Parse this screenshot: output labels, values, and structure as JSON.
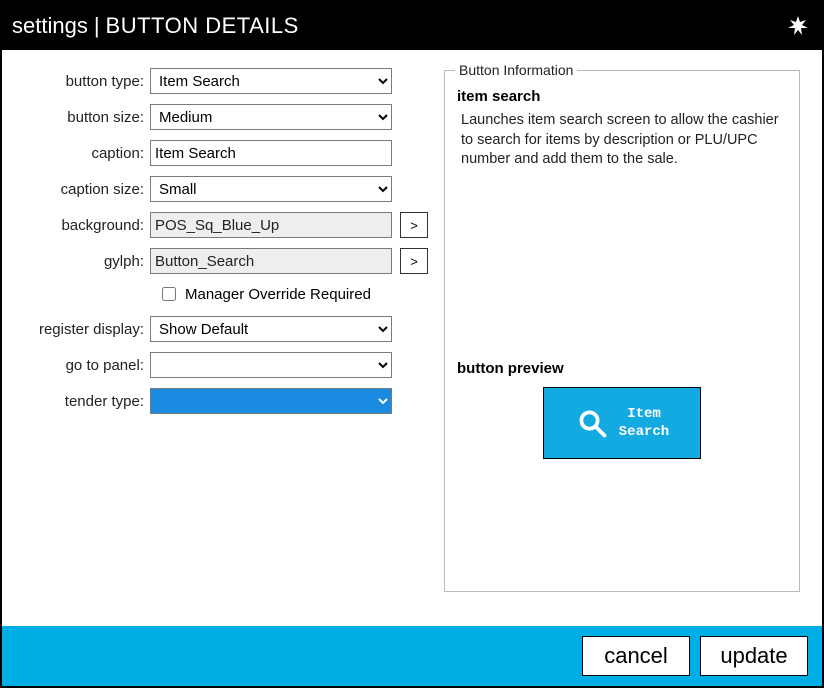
{
  "header": {
    "left": "settings",
    "right": "BUTTON DETAILS"
  },
  "form": {
    "button_type": {
      "label": "button type:",
      "value": "Item Search"
    },
    "button_size": {
      "label": "button size:",
      "value": "Medium"
    },
    "caption": {
      "label": "caption:",
      "value": "Item Search"
    },
    "caption_size": {
      "label": "caption size:",
      "value": "Small"
    },
    "background": {
      "label": "background:",
      "value": "POS_Sq_Blue_Up",
      "picker": ">"
    },
    "glyph": {
      "label": "gylph:",
      "value": "Button_Search",
      "picker": ">"
    },
    "manager_override": {
      "label": "Manager Override Required",
      "checked": false
    },
    "register_display": {
      "label": "register display:",
      "value": "Show Default"
    },
    "go_to_panel": {
      "label": "go to panel:",
      "value": ""
    },
    "tender_type": {
      "label": "tender type:",
      "value": ""
    }
  },
  "info": {
    "legend": "Button Information",
    "title": "item search",
    "description": "Launches item search screen to allow the cashier to search for items by description or PLU/UPC number and add them to the sale.",
    "preview_label": "button preview",
    "preview_text_line1": "Item",
    "preview_text_line2": "Search"
  },
  "footer": {
    "cancel": "cancel",
    "update": "update"
  }
}
